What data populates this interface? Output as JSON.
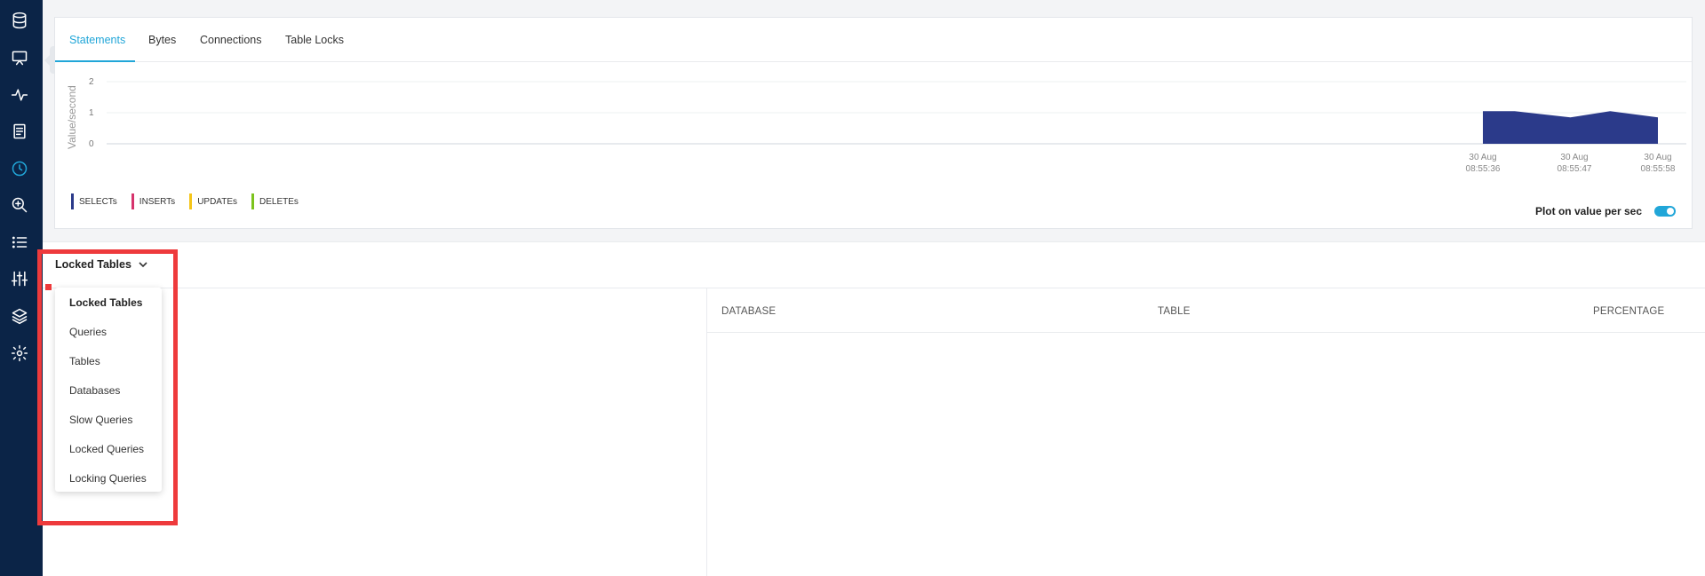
{
  "sidebar": {
    "icons": [
      {
        "name": "database-icon"
      },
      {
        "name": "monitor-icon"
      },
      {
        "name": "activity-icon"
      },
      {
        "name": "document-icon"
      },
      {
        "name": "clock-icon",
        "active": true
      },
      {
        "name": "search-zoom-icon"
      },
      {
        "name": "list-icon"
      },
      {
        "name": "sliders-icon"
      },
      {
        "name": "layers-icon"
      },
      {
        "name": "settings-icon"
      }
    ]
  },
  "tabs": [
    "Statements",
    "Bytes",
    "Connections",
    "Table Locks"
  ],
  "chart_data": {
    "type": "area",
    "ylabel": "Value/second",
    "yticks": [
      "2",
      "1",
      "0"
    ],
    "ylim": [
      0,
      2
    ],
    "x_tick_labels": [
      {
        "date": "30 Aug",
        "time": "08:55:36"
      },
      {
        "date": "30 Aug",
        "time": "08:55:47"
      },
      {
        "date": "30 Aug",
        "time": "08:55:58"
      }
    ],
    "series": [
      {
        "name": "SELECTs",
        "color": "#2b3a8a",
        "x": [
          "08:55:36",
          "08:55:40",
          "08:55:47",
          "08:55:52",
          "08:55:58"
        ],
        "values": [
          1.05,
          1.05,
          0.85,
          1.05,
          0.85
        ]
      },
      {
        "name": "INSERTs",
        "color": "#d6336c",
        "values": []
      },
      {
        "name": "UPDATEs",
        "color": "#f5c518",
        "values": []
      },
      {
        "name": "DELETEs",
        "color": "#7cc31d",
        "values": []
      }
    ],
    "grid": true,
    "legend": "bottom-left"
  },
  "plot_toggle": {
    "label": "Plot on value per sec",
    "on": true
  },
  "dropdown": {
    "selected": "Locked Tables",
    "options": [
      "Locked Tables",
      "Queries",
      "Tables",
      "Databases",
      "Slow Queries",
      "Locked Queries",
      "Locking Queries"
    ]
  },
  "table": {
    "columns": [
      "DATABASE",
      "TABLE",
      "PERCENTAGE"
    ]
  },
  "colors": {
    "accent": "#21a6d8",
    "sidebar": "#0b2447",
    "highlight": "#ee3a3c"
  }
}
